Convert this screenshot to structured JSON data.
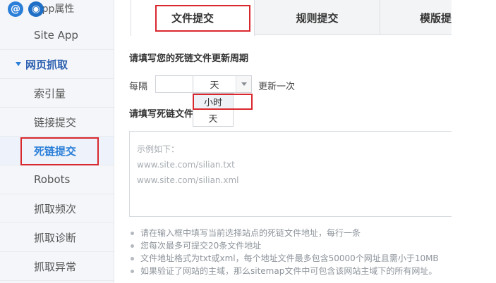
{
  "sidebar": {
    "top_badges": {
      "at": "@",
      "eye": "◉"
    },
    "top_label": "App属性",
    "items": [
      {
        "label": "Site App"
      },
      {
        "label": "网页抓取"
      },
      {
        "label": "索引量"
      },
      {
        "label": "链接提交"
      },
      {
        "label": "死链提交"
      },
      {
        "label": "Robots"
      },
      {
        "label": "抓取频次"
      },
      {
        "label": "抓取诊断"
      },
      {
        "label": "抓取异常"
      }
    ]
  },
  "tabs": [
    {
      "label": "文件提交"
    },
    {
      "label": "规则提交"
    },
    {
      "label": "模版提"
    }
  ],
  "main": {
    "cycle_heading": "请填写您的死链文件更新周期",
    "every_label": "每隔",
    "interval_value": "",
    "unit_selected": "天",
    "update_suffix": "更新一次",
    "dropdown_options": [
      "小时",
      "天"
    ],
    "file_heading": "请填写死链文件",
    "placeholder_lines": [
      "示例如下：",
      "www.site.com/silian.txt",
      "www.site.com/silian.xml"
    ],
    "tips": [
      "请在输入框中填写当前选择站点的死链文件地址，每行一条",
      "您每次最多可提交20条文件地址",
      "文件地址格式为txt或xml，每个地址文件最多包含50000个网址且需小于10MB",
      "如果验证了网站的主域，那么sitemap文件中可包含该网站主域下的所有网址。"
    ]
  },
  "colors": {
    "highlight": "#d9272e",
    "accent": "#2b7fd8"
  }
}
